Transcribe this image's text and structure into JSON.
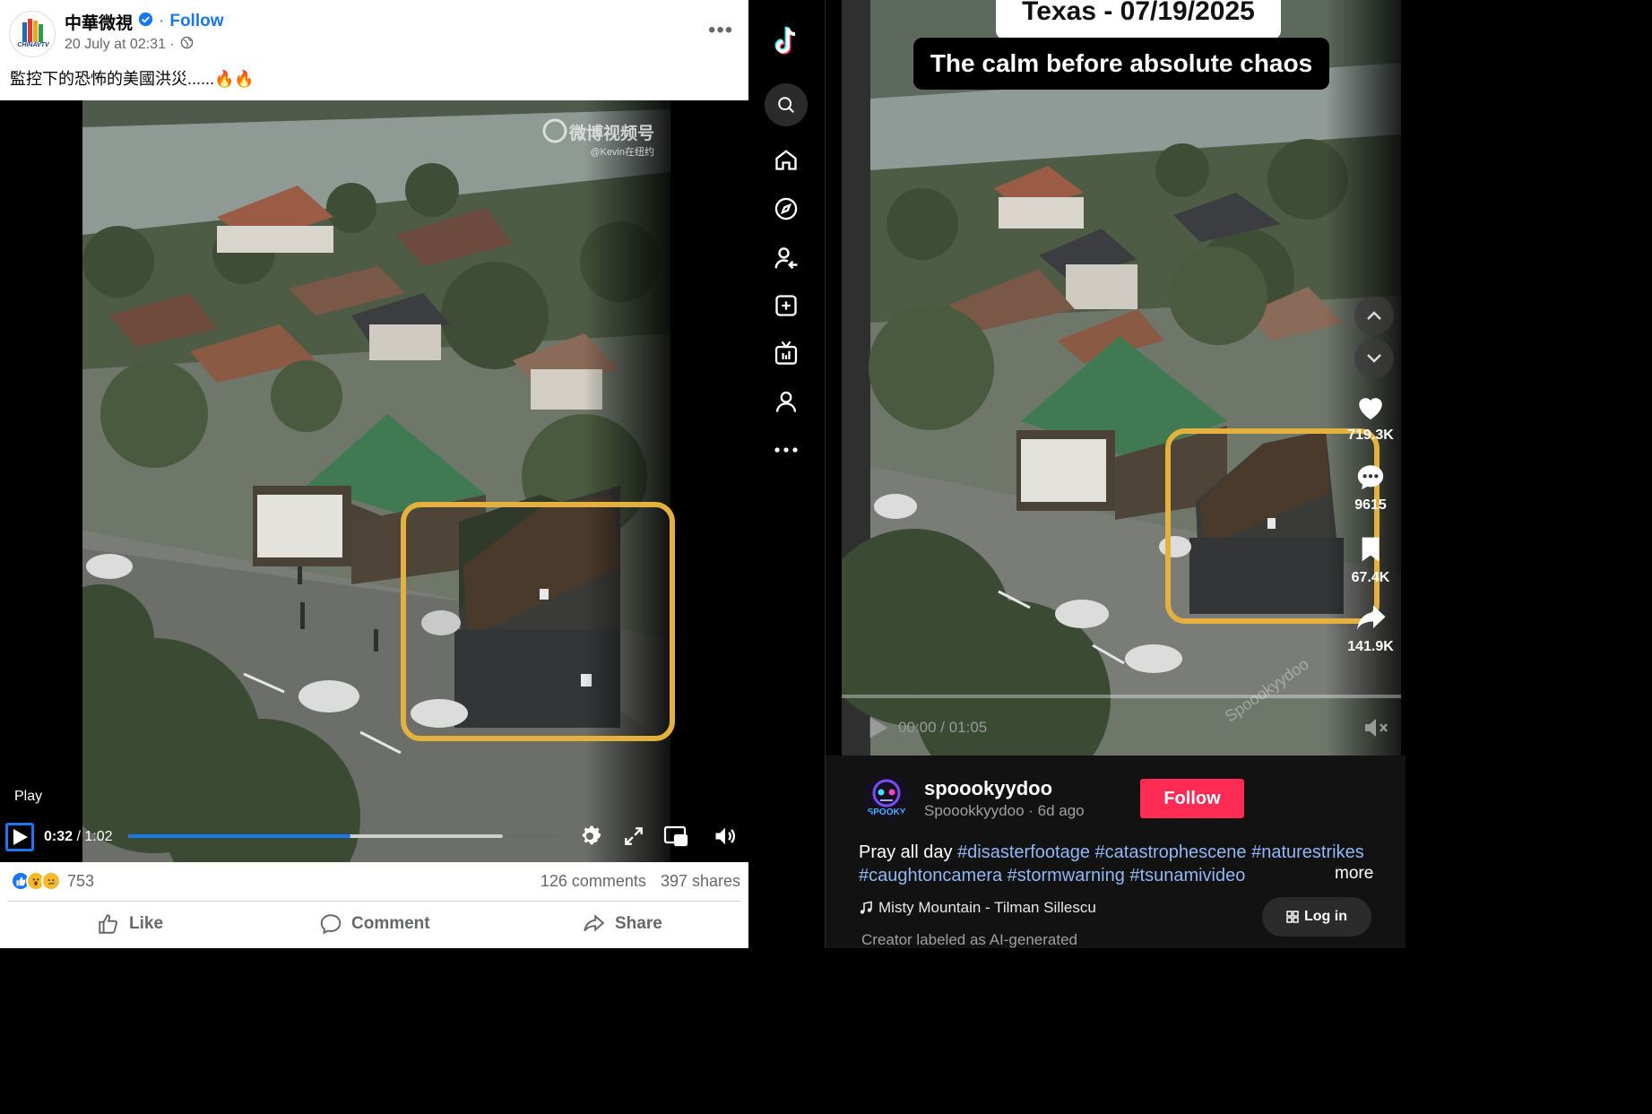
{
  "facebook": {
    "page_name": "中華微視",
    "follow_label": "Follow",
    "dot": "·",
    "post_date": "20 July at 02:31 ·",
    "caption": "監控下的恐怖的美國洪災......🔥🔥",
    "avatar_logo_text": "CHINAVTV",
    "video": {
      "watermark_main": "微博视频号",
      "watermark_sub": "@Kevin在纽约",
      "play_label": "Play",
      "current_time": "0:32",
      "duration": "/ 1:02",
      "progress_fraction": 0.516,
      "buffered_fraction": 0.87
    },
    "reaction_count": "753",
    "comments_count": "126 comments",
    "shares_count": "397 shares",
    "actions": {
      "like": "Like",
      "comment": "Comment",
      "share": "Share"
    }
  },
  "tiktok": {
    "nav_icons": [
      "tiktok-logo-icon",
      "search-icon",
      "home-icon",
      "explore-icon",
      "following-icon",
      "upload-icon",
      "live-icon",
      "profile-icon",
      "more-icon"
    ],
    "video": {
      "title_overlay": "Texas - 07/19/2025",
      "subtitle_overlay": "The calm before absolute chaos",
      "watermark": "Spoookyydoo",
      "time": "00:00 / 01:05",
      "likes": "719.3K",
      "comments": "9615",
      "saves": "67.4K",
      "shares": "141.9K"
    },
    "username": "spoookyydoo",
    "handle_line": "Spoookkyydoo · 6d ago",
    "avatar_text": "SPOOKY",
    "follow_label": "Follow",
    "desc_prefix": "Pray all day ",
    "hashtags": [
      "#disasterfootage",
      "#catastrophescene",
      "#naturestrikes",
      "#caughtoncamera",
      "#stormwarning",
      "#tsunamivideo"
    ],
    "more_label": "more",
    "music": "Misty Mountain - Tilman Sillescu",
    "ai_label": "Creator labeled as AI-generated",
    "login_label": "Log in"
  },
  "colors": {
    "highlight": "#e5b13e",
    "fb_blue": "#1877f2",
    "tt_red": "#fe2c55"
  }
}
